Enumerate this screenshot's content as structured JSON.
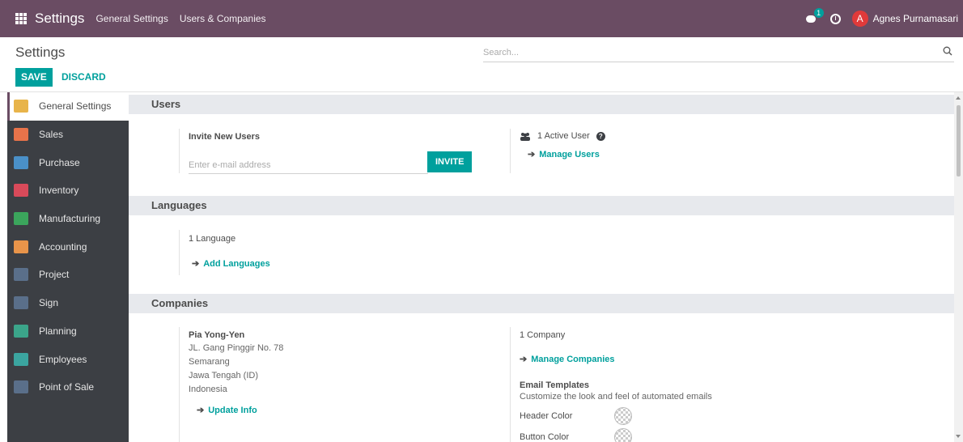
{
  "topbar": {
    "app_name": "Settings",
    "menu": [
      "General Settings",
      "Users & Companies"
    ],
    "chat_badge": "1",
    "user_initial": "A",
    "user_name": "Agnes Purnamasari"
  },
  "control": {
    "breadcrumb": "Settings",
    "save_label": "SAVE",
    "discard_label": "DISCARD",
    "search_placeholder": "Search..."
  },
  "sidebar": {
    "items": [
      {
        "label": "General Settings",
        "icon": "gear-icon",
        "color": "#e8b44a"
      },
      {
        "label": "Sales",
        "icon": "chart-icon",
        "color": "#e8734a"
      },
      {
        "label": "Purchase",
        "icon": "credit-card-icon",
        "color": "#4a90c8"
      },
      {
        "label": "Inventory",
        "icon": "box-icon",
        "color": "#d94a5a"
      },
      {
        "label": "Manufacturing",
        "icon": "wrench-icon",
        "color": "#3ba55c"
      },
      {
        "label": "Accounting",
        "icon": "file-icon",
        "color": "#e8944a"
      },
      {
        "label": "Project",
        "icon": "puzzle-icon",
        "color": "#5a6f8a"
      },
      {
        "label": "Sign",
        "icon": "signature-icon",
        "color": "#5a6f8a"
      },
      {
        "label": "Planning",
        "icon": "planning-icon",
        "color": "#3ba58a"
      },
      {
        "label": "Employees",
        "icon": "users-icon",
        "color": "#3ba5a0"
      },
      {
        "label": "Point of Sale",
        "icon": "store-icon",
        "color": "#5a6f8a"
      }
    ]
  },
  "users": {
    "heading": "Users",
    "invite_title": "Invite New Users",
    "email_placeholder": "Enter e-mail address",
    "invite_label": "INVITE",
    "active_users": "1 Active User",
    "manage_users": "Manage Users"
  },
  "languages": {
    "heading": "Languages",
    "count": "1 Language",
    "add_languages": "Add Languages"
  },
  "companies": {
    "heading": "Companies",
    "company_name": "Pia Yong-Yen",
    "address_lines": [
      "JL. Gang Pinggir No. 78",
      "Semarang",
      "Jawa Tengah (ID)",
      "Indonesia"
    ],
    "update_info": "Update Info",
    "company_count": "1 Company",
    "manage_companies": "Manage Companies",
    "email_templates_title": "Email Templates",
    "email_templates_desc": "Customize the look and feel of automated emails",
    "header_color_label": "Header Color",
    "button_color_label": "Button Color"
  }
}
